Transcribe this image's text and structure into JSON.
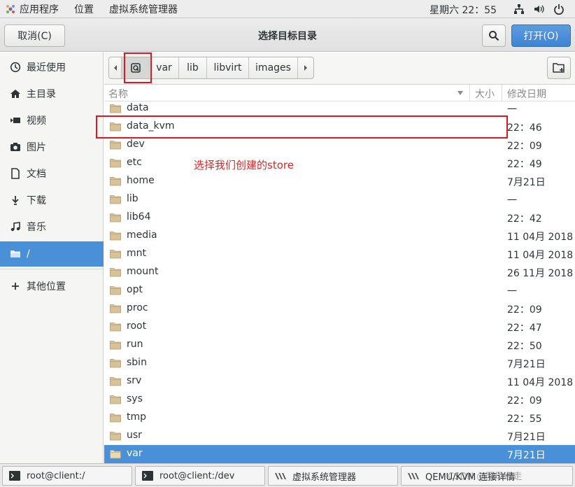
{
  "topbar": {
    "menus": [
      "应用程序",
      "位置",
      "虚拟系统管理器"
    ],
    "clock": "星期六  22：55"
  },
  "header": {
    "cancel_label": "取消(C)",
    "title": "选择目标目录",
    "open_label": "打开(O)"
  },
  "sidebar": {
    "items": [
      {
        "label": "最近使用",
        "icon": "clock-icon"
      },
      {
        "label": "主目录",
        "icon": "home-icon"
      },
      {
        "label": "视频",
        "icon": "video-icon"
      },
      {
        "label": "图片",
        "icon": "camera-icon"
      },
      {
        "label": "文档",
        "icon": "document-icon"
      },
      {
        "label": "下载",
        "icon": "download-icon"
      },
      {
        "label": "音乐",
        "icon": "music-icon"
      },
      {
        "label": "/",
        "icon": "folder-open-icon",
        "active": true
      }
    ],
    "other_locations": "其他位置"
  },
  "pathbar": {
    "crumbs": [
      "var",
      "lib",
      "libvirt",
      "images"
    ]
  },
  "columns": {
    "name": "名称",
    "size": "大小",
    "modified": "修改日期"
  },
  "rows": [
    {
      "name": "data",
      "modified": "一"
    },
    {
      "name": "data_kvm",
      "modified": "22：46"
    },
    {
      "name": "dev",
      "modified": "22：09"
    },
    {
      "name": "etc",
      "modified": "22：49"
    },
    {
      "name": "home",
      "modified": "7月21日"
    },
    {
      "name": "lib",
      "modified": "一"
    },
    {
      "name": "lib64",
      "modified": "22：42"
    },
    {
      "name": "media",
      "modified": "11 04月 2018"
    },
    {
      "name": "mnt",
      "modified": "11 04月 2018"
    },
    {
      "name": "mount",
      "modified": "26 11月 2018"
    },
    {
      "name": "opt",
      "modified": "一"
    },
    {
      "name": "proc",
      "modified": "22：09"
    },
    {
      "name": "root",
      "modified": "22：47"
    },
    {
      "name": "run",
      "modified": "22：50"
    },
    {
      "name": "sbin",
      "modified": "7月21日"
    },
    {
      "name": "srv",
      "modified": "11 04月 2018"
    },
    {
      "name": "sys",
      "modified": "22：09"
    },
    {
      "name": "tmp",
      "modified": "22：55"
    },
    {
      "name": "usr",
      "modified": "7月21日"
    },
    {
      "name": "var",
      "modified": "7月21日",
      "selected": true
    }
  ],
  "annotation": "选择我们创建的store",
  "taskbar": [
    {
      "label": "root@client:/",
      "icon": "terminal-icon"
    },
    {
      "label": "root@client:/dev",
      "icon": "terminal-icon"
    },
    {
      "label": "虚拟系统管理器",
      "icon": "virt-manager-icon"
    },
    {
      "label": "QEMU/KVM 连接详情",
      "icon": "virt-manager-icon"
    }
  ],
  "watermark": "CSDN @陌风远走",
  "colors": {
    "accent": "#4a90d9",
    "annotation": "#e02424",
    "folder": "#d8c29a"
  }
}
